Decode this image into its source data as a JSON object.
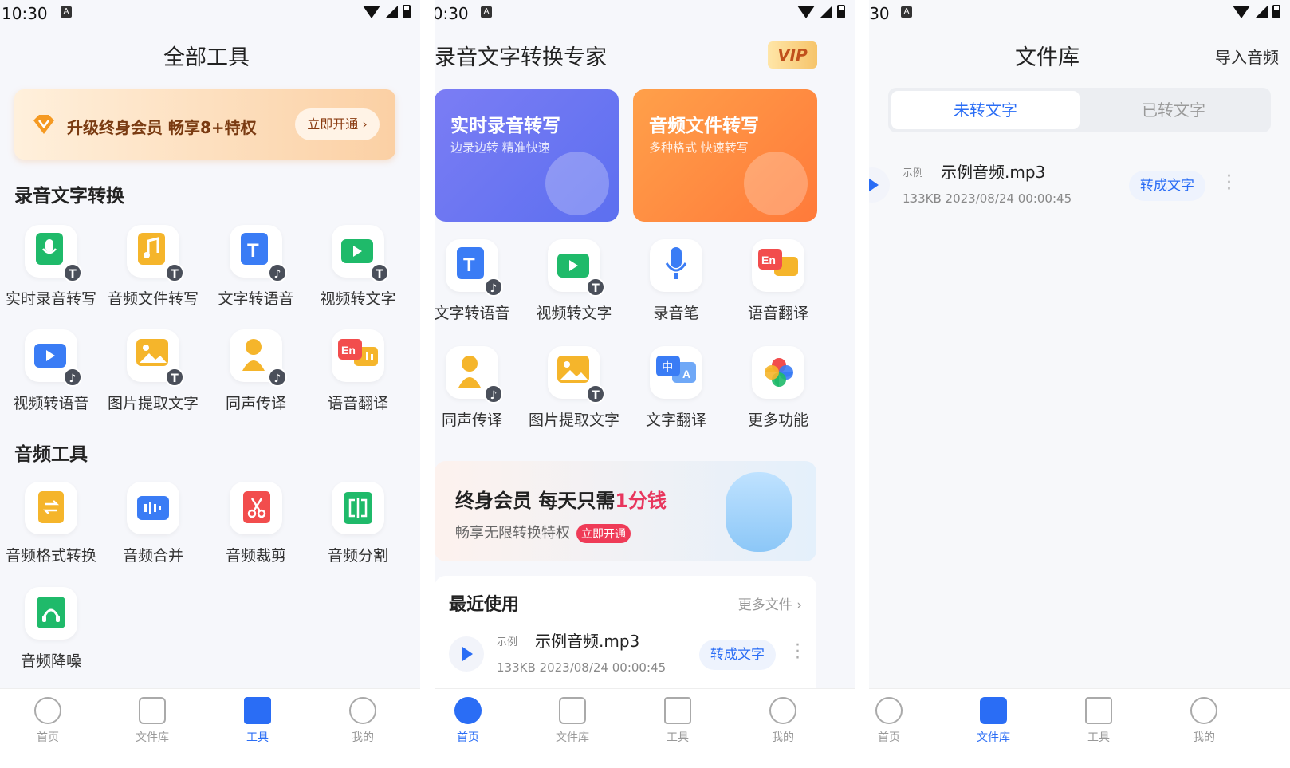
{
  "colors": {
    "accent": "#2a6df5",
    "promo_red": "#e8365d",
    "vip_text": "#c0501c"
  },
  "status": {
    "time": "10:30",
    "notif": "A"
  },
  "panel1": {
    "title": "全部工具",
    "banner": {
      "text": "升级终身会员 畅享8+特权",
      "button": "立即开通 ›"
    },
    "section1": "录音文字转换",
    "section2": "音频工具",
    "tools_a": [
      {
        "label": "实时录音转写",
        "icon": "mic-t-icon"
      },
      {
        "label": "音频文件转写",
        "icon": "music-t-icon"
      },
      {
        "label": "文字转语音",
        "icon": "text-speech-icon"
      },
      {
        "label": "视频转文字",
        "icon": "video-t-icon"
      },
      {
        "label": "视频转语音",
        "icon": "video-speech-icon"
      },
      {
        "label": "图片提取文字",
        "icon": "image-t-icon"
      },
      {
        "label": "同声传译",
        "icon": "person-speech-icon"
      },
      {
        "label": "语音翻译",
        "icon": "en-translate-icon"
      }
    ],
    "tools_b": [
      {
        "label": "音频格式转换",
        "icon": "format-convert-icon"
      },
      {
        "label": "音频合并",
        "icon": "merge-icon"
      },
      {
        "label": "音频裁剪",
        "icon": "scissors-icon"
      },
      {
        "label": "音频分割",
        "icon": "split-icon"
      },
      {
        "label": "音频降噪",
        "icon": "denoise-icon"
      }
    ]
  },
  "panel2": {
    "title": "录音文字转换专家",
    "vip": "VIP",
    "card_a": {
      "title": "实时录音转写",
      "sub": "边录边转 精准快速"
    },
    "card_b": {
      "title": "音频文件转写",
      "sub": "多种格式 快速转写"
    },
    "tools": [
      {
        "label": "文字转语音",
        "icon": "text-speech-icon"
      },
      {
        "label": "视频转文字",
        "icon": "video-t-icon"
      },
      {
        "label": "录音笔",
        "icon": "microphone-icon"
      },
      {
        "label": "语音翻译",
        "icon": "en-translate-icon"
      },
      {
        "label": "同声传译",
        "icon": "person-speech-icon"
      },
      {
        "label": "图片提取文字",
        "icon": "image-t-icon"
      },
      {
        "label": "文字翻译",
        "icon": "zh-a-translate-icon"
      },
      {
        "label": "更多功能",
        "icon": "pinwheel-icon"
      }
    ],
    "promo": {
      "line1": "终身会员  每天只需",
      "line1_red": "1分钱",
      "line2": "畅享无限转换特权",
      "tag": "立即开通"
    },
    "recent": {
      "title": "最近使用",
      "more": "更多文件 ›"
    }
  },
  "file": {
    "example": "示例",
    "name": "示例音频.mp3",
    "meta": "133KB 2023/08/24 00:00:45",
    "convert": "转成文字"
  },
  "panel3": {
    "title": "文件库",
    "import": "导入音频",
    "seg_on": "未转文字",
    "seg_off": "已转文字"
  },
  "tabs": {
    "home": "首页",
    "library": "文件库",
    "tools": "工具",
    "mine": "我的"
  }
}
